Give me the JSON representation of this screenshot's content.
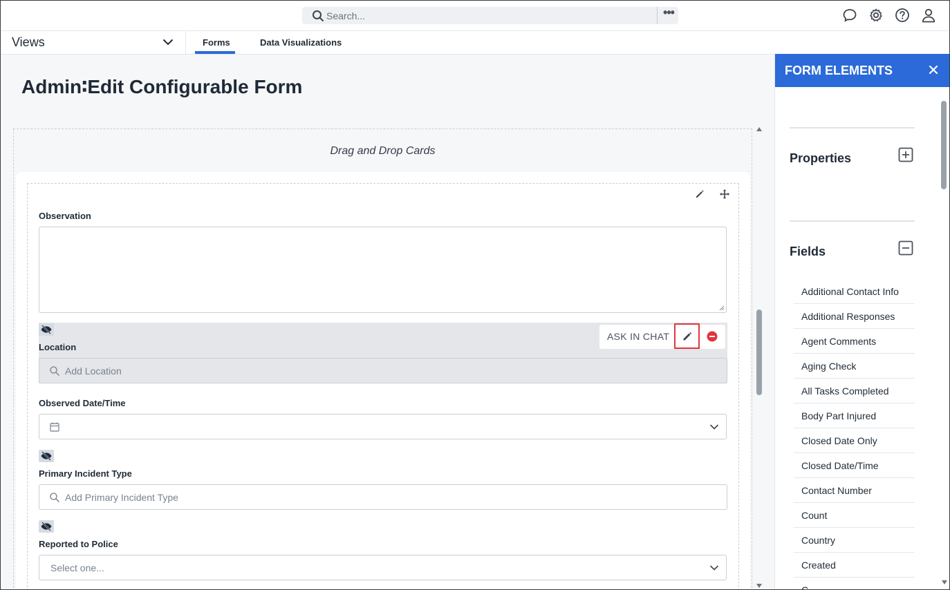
{
  "topbar": {
    "search_placeholder": "Search...",
    "more_label": "•••",
    "icons": [
      "chat-icon",
      "gear-icon",
      "help-icon",
      "user-icon"
    ]
  },
  "subnav": {
    "views_label": "Views",
    "tabs": [
      {
        "label": "Forms",
        "active": true
      },
      {
        "label": "Data Visualizations",
        "active": false
      }
    ]
  },
  "page": {
    "title": "Admin∶Edit Configurable Form"
  },
  "canvas": {
    "dropzone_title": "Drag and Drop Cards",
    "fields": {
      "observation_label": "Observation",
      "location_label": "Location",
      "location_placeholder": "Add Location",
      "observed_label": "Observed Date/Time",
      "primary_label": "Primary Incident Type",
      "primary_placeholder": "Add Primary Incident Type",
      "police_label": "Reported to Police",
      "police_placeholder": "Select one..."
    },
    "actions": {
      "ask_in_chat": "ASK IN CHAT"
    }
  },
  "panel": {
    "title": "FORM ELEMENTS",
    "properties_label": "Properties",
    "fields_label": "Fields",
    "fields": [
      "Additional Contact Info",
      "Additional Responses",
      "Agent Comments",
      "Aging Check",
      "All Tasks Completed",
      "Body Part Injured",
      "Closed Date Only",
      "Closed Date/Time",
      "Contact Number",
      "Count",
      "Country",
      "Created",
      "C..."
    ]
  },
  "colors": {
    "accent": "#2b6ad8",
    "highlight": "#e0353d",
    "remove": "#e0353d"
  }
}
